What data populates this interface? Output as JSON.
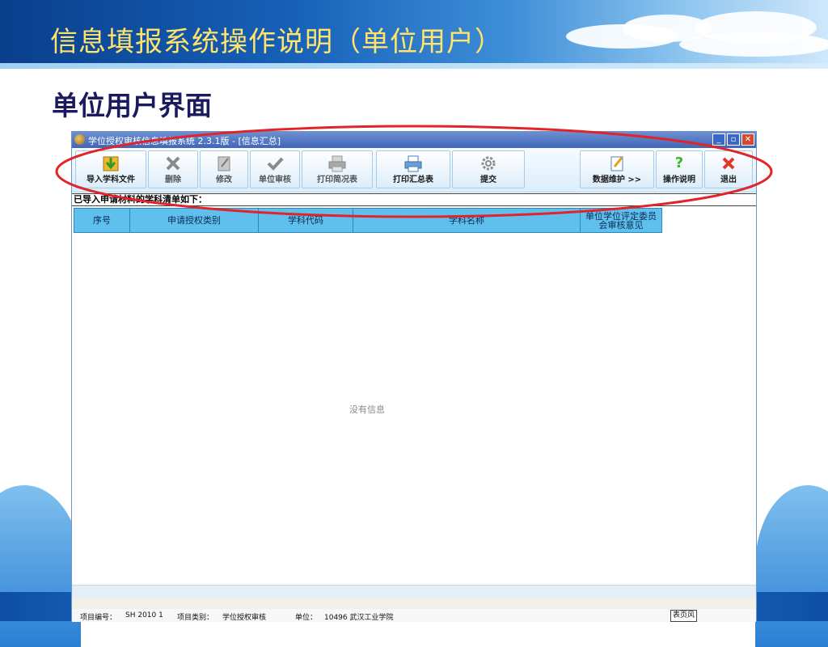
{
  "slide": {
    "title": "信息填报系统操作说明（单位用户）",
    "subtitle": "单位用户界面"
  },
  "window": {
    "title": "学位授权审核信息填报系统 2.3.1版 - [信息汇总]",
    "minimize": "_",
    "maximize": "▫",
    "close": "✕"
  },
  "toolbar": {
    "import": "导入学科文件",
    "delete": "删除",
    "edit": "修改",
    "unit_review": "单位审核",
    "print_brief": "打印简况表",
    "print_summary": "打印汇总表",
    "submit": "提交",
    "data_maintenance": "数据维护  >>",
    "help": "操作说明",
    "exit": "退出"
  },
  "list": {
    "label": "已导入申请材料的学科清单如下：",
    "columns": [
      "序号",
      "申请授权类别",
      "学科代码",
      "学科名称",
      "单位学位评定委员会审核意见"
    ],
    "empty_message": "没有信息"
  },
  "status": {
    "project_code_label": "项目编号：",
    "project_code": "SH 2010 1",
    "project_type_label": "项目类别：",
    "project_type": "学位授权审核",
    "unit_label": "单位：",
    "unit": "10496 武汉工业学院",
    "badge": "表页风"
  },
  "colors": {
    "annotation": "#e0242a",
    "header_cell": "#5fc0ee",
    "title_text": "#ffe36a"
  }
}
